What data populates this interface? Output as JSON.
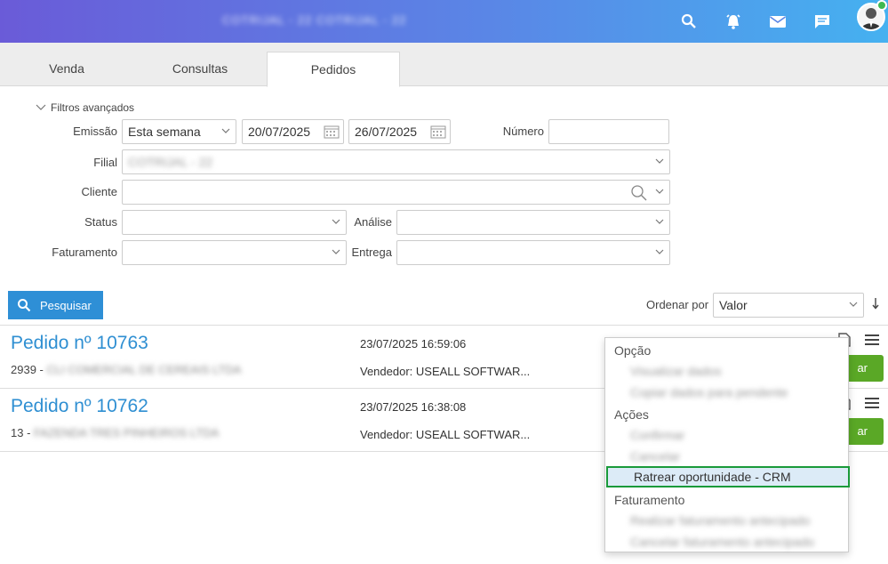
{
  "header": {
    "brand": "COTRIJAL - 22   COTRIJAL - 22",
    "icons": [
      "search-icon",
      "alarm-icon",
      "mail-icon",
      "chat-icon",
      "avatar"
    ]
  },
  "tabs": [
    {
      "label": "Venda"
    },
    {
      "label": "Consultas"
    },
    {
      "label": "Pedidos"
    }
  ],
  "filters": {
    "title": "Filtros avançados",
    "emissao_label": "Emissão",
    "emissao_value": "Esta semana",
    "date_from": "20/07/2025",
    "date_to": "26/07/2025",
    "numero_label": "Número",
    "filial_label": "Filial",
    "filial_value": "COTRIJAL - 22",
    "cliente_label": "Cliente",
    "status_label": "Status",
    "analise_label": "Análise",
    "faturamento_label": "Faturamento",
    "entrega_label": "Entrega"
  },
  "actions": {
    "search_label": "Pesquisar",
    "order_by_label": "Ordenar por",
    "order_by_value": "Valor"
  },
  "orders": [
    {
      "title": "Pedido nº 10763",
      "client_code": "2939 -",
      "client_name": "CLI COMERCIAL DE CEREAIS LTDA",
      "datetime": "23/07/2025 16:59:06",
      "seller": "Vendedor: USEALL SOFTWAR...",
      "button": "ar"
    },
    {
      "title": "Pedido nº 10762",
      "client_code": "13 -",
      "client_name": "FAZENDA TRES PINHEIROS LTDA",
      "datetime": "23/07/2025 16:38:08",
      "seller": "Vendedor: USEALL SOFTWAR...",
      "button": "ar"
    }
  ],
  "menu": {
    "opcao_header": "Opção",
    "opcao_items": [
      "Visualizar dados",
      "Copiar dados para pendente"
    ],
    "acoes_header": "Ações",
    "acoes_items": [
      "Confirmar",
      "Cancelar"
    ],
    "active_item": "Ratrear oportunidade - CRM",
    "faturamento_header": "Faturamento",
    "faturamento_items": [
      "Realizar faturamento antecipado",
      "Cancelar faturamento antecipado"
    ]
  },
  "colors": {
    "primary": "#2e8fd6",
    "link": "#2f8fd2",
    "success": "#5aa826",
    "highlight_border": "#1a9a3a"
  }
}
